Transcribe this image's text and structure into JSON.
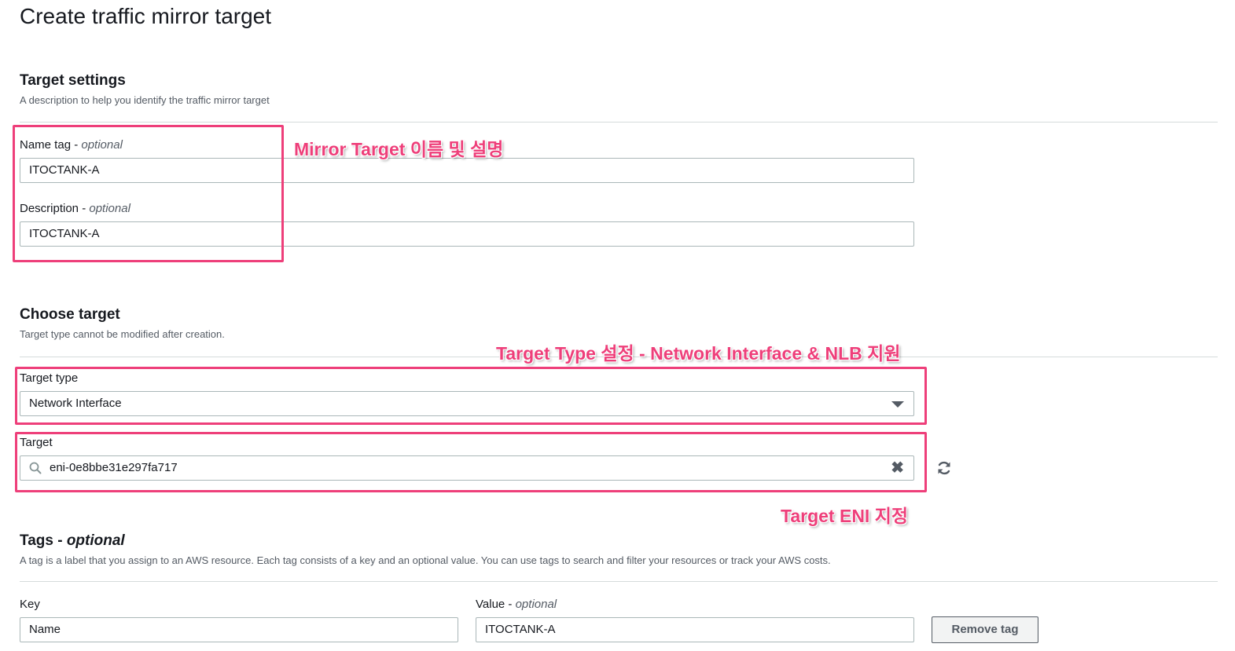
{
  "page": {
    "title": "Create traffic mirror target"
  },
  "target_settings": {
    "title": "Target settings",
    "description": "A description to help you identify the traffic mirror target",
    "name_tag": {
      "label": "Name tag - ",
      "optional": "optional",
      "value": "ITOCTANK-A"
    },
    "description_field": {
      "label": "Description - ",
      "optional": "optional",
      "value": "ITOCTANK-A"
    }
  },
  "choose_target": {
    "title": "Choose target",
    "description": "Target type cannot be modified after creation.",
    "target_type": {
      "label": "Target type",
      "value": "Network Interface"
    },
    "target": {
      "label": "Target",
      "value": "eni-0e8bbe31e297fa717"
    }
  },
  "tags": {
    "title": "Tags - ",
    "title_optional": "optional",
    "description": "A tag is a label that you assign to an AWS resource. Each tag consists of a key and an optional value. You can use tags to search and filter your resources or track your AWS costs.",
    "key_label": "Key",
    "value_label": "Value - ",
    "value_optional": "optional",
    "rows": [
      {
        "key": "Name",
        "value": "ITOCTANK-A"
      }
    ],
    "remove_label": "Remove tag"
  },
  "annotations": {
    "name_desc": "Mirror Target 이름 및 설명",
    "target_type": "Target Type 설정 - Network Interface & NLB 지원",
    "target_eni": "Target ENI 지정"
  },
  "icons": {
    "dropdown": "caret-down-icon",
    "search": "search-icon",
    "clear": "clear-icon",
    "refresh": "refresh-icon"
  },
  "colors": {
    "highlight": "#ee3f7a",
    "border": "#aab7b8",
    "text": "#16191f",
    "muted": "#545b64"
  }
}
